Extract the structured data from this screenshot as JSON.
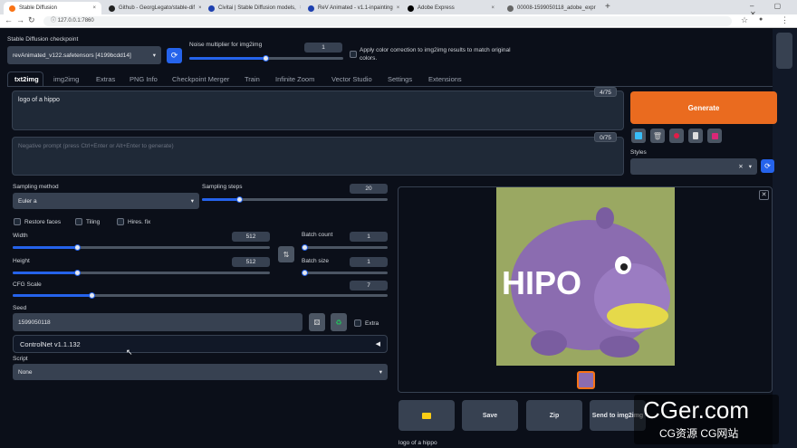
{
  "browser": {
    "tabs": [
      {
        "label": "Stable Diffusion"
      },
      {
        "label": "Github - GeorgLegato/stable-dif"
      },
      {
        "label": "Civitai | Stable Diffusion models,"
      },
      {
        "label": "ReV Animated - v1.1-inpainting"
      },
      {
        "label": "Adobe Express"
      },
      {
        "label": "00008-1599050118_adobe_expr"
      }
    ],
    "url": "127.0.0.1:7860",
    "new_tab": "+"
  },
  "top": {
    "checkpoint_label": "Stable Diffusion checkpoint",
    "checkpoint_value": "revAnimated_v122.safetensors [4199bcdd14]",
    "noise_label": "Noise multiplier for img2img",
    "noise_value": "1",
    "color_correction": "Apply color correction to img2img results to match original colors."
  },
  "nav_tabs": [
    "txt2img",
    "img2img",
    "Extras",
    "PNG Info",
    "Checkpoint Merger",
    "Train",
    "Infinite Zoom",
    "Vector Studio",
    "Settings",
    "Extensions"
  ],
  "prompt": {
    "value": "logo of a hippo",
    "counter": "4/75",
    "negative_placeholder": "Negative prompt (press Ctrl+Enter or Alt+Enter to generate)",
    "negative_counter": "0/75"
  },
  "generate_label": "Generate",
  "styles_label": "Styles",
  "sampling": {
    "method_label": "Sampling method",
    "method_value": "Euler a",
    "steps_label": "Sampling steps",
    "steps_value": "20",
    "steps_level": 0.2
  },
  "options": {
    "restore_faces": "Restore faces",
    "tiling": "Tiling",
    "hires": "Hires. fix"
  },
  "width": {
    "label": "Width",
    "value": "512",
    "level": 0.25
  },
  "height": {
    "label": "Height",
    "value": "512",
    "level": 0.25
  },
  "batch_count": {
    "label": "Batch count",
    "value": "1",
    "level": 0.0
  },
  "batch_size": {
    "label": "Batch size",
    "value": "1",
    "level": 0.0
  },
  "cfg": {
    "label": "CFG Scale",
    "value": "7",
    "level": 0.21
  },
  "seed": {
    "label": "Seed",
    "value": "1599050118",
    "extra": "Extra"
  },
  "controlnet": {
    "label": "ControlNet v1.1.132"
  },
  "script": {
    "label": "Script",
    "value": "None"
  },
  "output": {
    "image_text": "HIPO",
    "buttons": {
      "save": "Save",
      "zip": "Zip",
      "send": "Send to img2img"
    },
    "caption": "logo of a hippo"
  },
  "watermark": {
    "main": "CGer.com",
    "sub": "CG资源 CG网站"
  },
  "colors": {
    "accent": "#f97316",
    "bg": "#0b0f19",
    "panel": "#1f2937",
    "slider": "#2563eb",
    "hippo": "#8b6cb0",
    "image_bg": "#9aa862"
  }
}
